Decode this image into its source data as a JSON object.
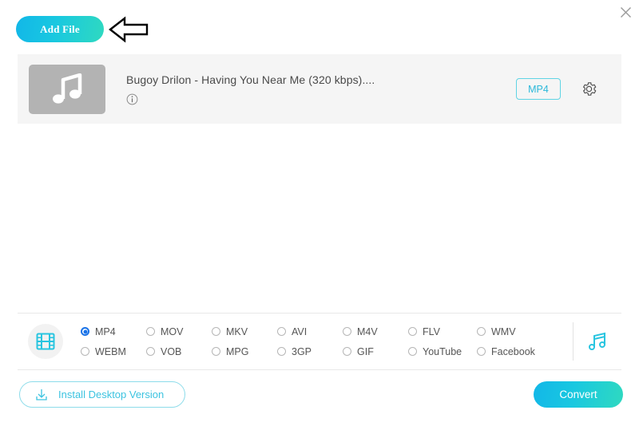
{
  "window": {
    "close_label": "close-icon"
  },
  "toolbar": {
    "add_file_label": "Add File",
    "arrow_hint": "left-arrow-annotation"
  },
  "file_card": {
    "thumbnail_icon": "music-note-icon",
    "file_name": "Bugoy Drilon - Having You Near Me (320 kbps)....",
    "info_icon": "info-icon",
    "output_format_badge": "MP4",
    "settings_icon": "gear-icon"
  },
  "format_bar": {
    "video_icon": "film-strip-icon",
    "audio_icon": "music-note-icon",
    "selected": "MP4",
    "options": [
      "MP4",
      "MOV",
      "MKV",
      "AVI",
      "M4V",
      "FLV",
      "WMV",
      "WEBM",
      "VOB",
      "MPG",
      "3GP",
      "GIF",
      "YouTube",
      "Facebook"
    ]
  },
  "footer": {
    "install_label": "Install Desktop Version",
    "install_icon": "download-icon",
    "convert_label": "Convert"
  },
  "colors": {
    "accent_start": "#12b7e8",
    "accent_end": "#2fd9c0",
    "cyan": "#2bb8da",
    "radio_selected": "#1a73e8",
    "card_bg": "#f5f5f5",
    "thumb_bg": "#b3b3b3"
  }
}
